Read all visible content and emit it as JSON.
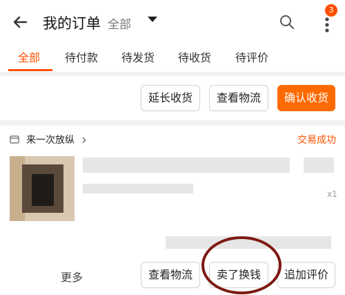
{
  "header": {
    "back_icon": "arrow-left-icon",
    "title": "我的订单",
    "scope": "全部",
    "search_icon": "search-icon",
    "more_icon": "more-vertical-icon",
    "badge_count": "3",
    "accent_color": "#ff5000"
  },
  "tabs": [
    {
      "label": "全部",
      "active": true
    },
    {
      "label": "待付款",
      "active": false
    },
    {
      "label": "待发货",
      "active": false
    },
    {
      "label": "待收货",
      "active": false
    },
    {
      "label": "待评价",
      "active": false
    }
  ],
  "order1": {
    "actions": [
      "延长收货",
      "查看物流",
      "确认收货"
    ]
  },
  "order2": {
    "shop_name": "来一次放纵",
    "status": "交易成功",
    "quantity": "x1",
    "more": "更多",
    "actions": [
      "查看物流",
      "卖了换钱",
      "追加评价"
    ]
  }
}
